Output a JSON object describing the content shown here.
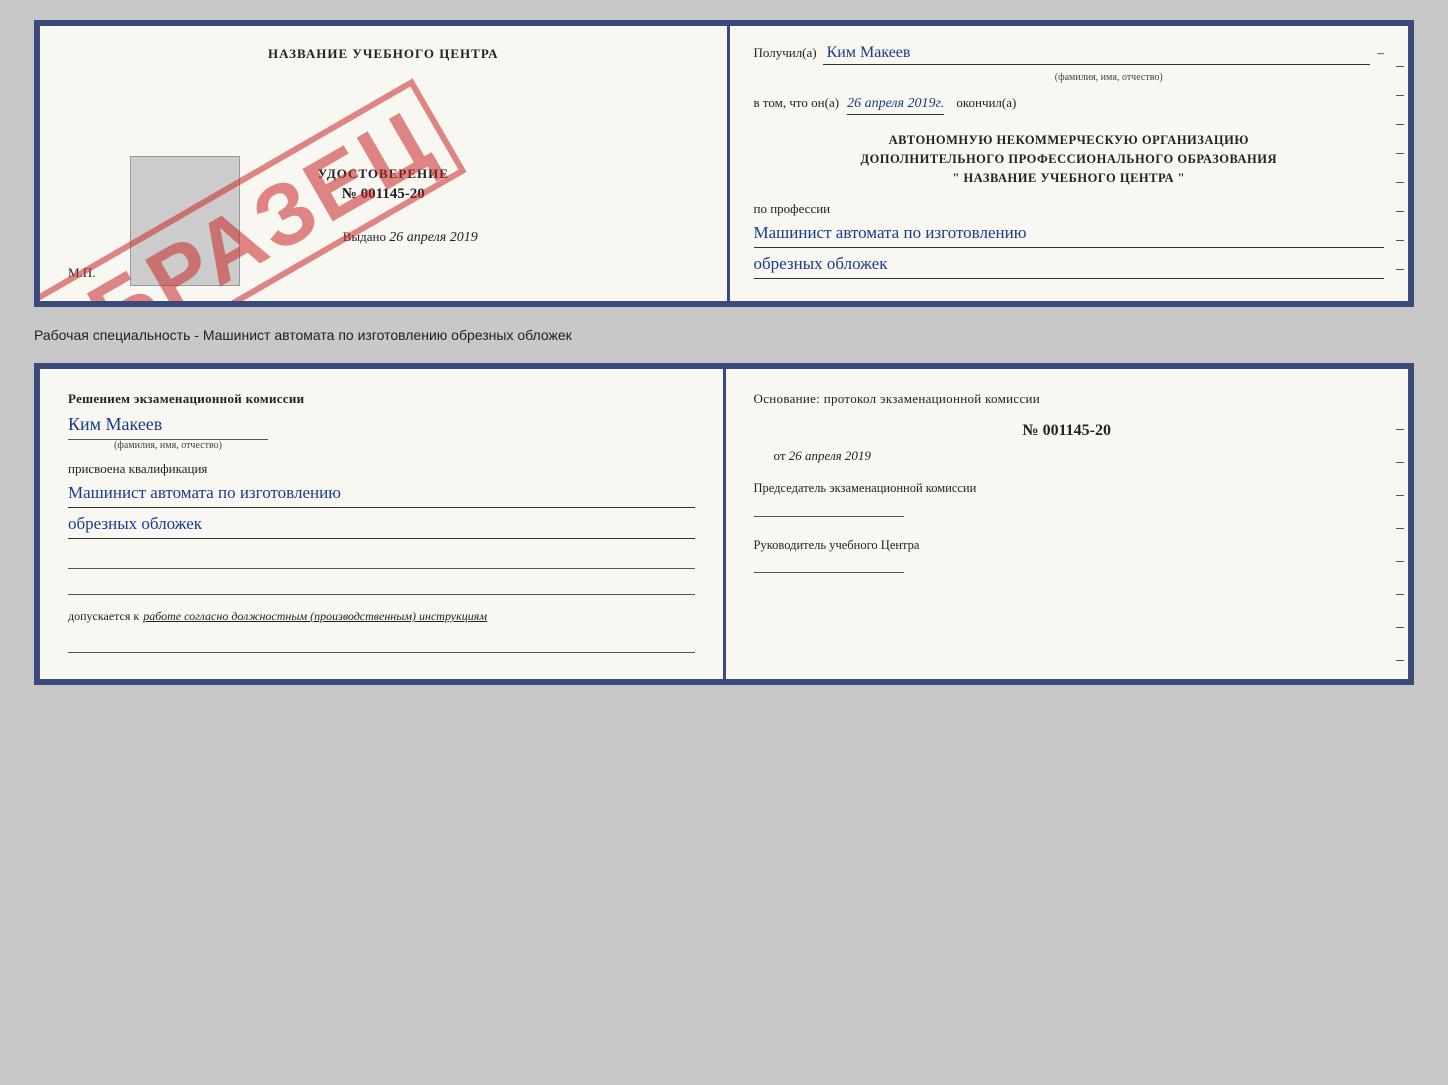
{
  "top_doc": {
    "left": {
      "center_title": "НАЗВАНИЕ УЧЕБНОГО ЦЕНТРА",
      "stamp": "ОБРАЗЕЦ",
      "udc_label": "УДОСТОВЕРЕНИЕ",
      "udc_number": "№ 001145-20",
      "vydano_prefix": "Выдано",
      "vydano_date": "26 апреля 2019",
      "mp_label": "М.П."
    },
    "right": {
      "poluchil_label": "Получил(а)",
      "fam_name": "Ким Макеев",
      "fam_sub": "(фамилия, имя, отчество)",
      "vtom_label": "в том, что он(а)",
      "vtom_date": "26 апреля 2019г.",
      "okonchil_label": "окончил(а)",
      "org_line1": "АВТОНОМНУЮ НЕКОММЕРЧЕСКУЮ ОРГАНИЗАЦИЮ",
      "org_line2": "ДОПОЛНИТЕЛЬНОГО ПРОФЕССИОНАЛЬНОГО ОБРАЗОВАНИЯ",
      "org_line3": "\"   НАЗВАНИЕ УЧЕБНОГО ЦЕНТРА   \"",
      "po_professii": "по профессии",
      "profession_line1": "Машинист автомата по изготовлению",
      "profession_line2": "обрезных обложек"
    }
  },
  "caption": "Рабочая специальность - Машинист автомата по изготовлению обрезных обложек",
  "bottom_doc": {
    "left": {
      "title_line1": "Решением экзаменационной комиссии",
      "name": "Ким Макеев",
      "fio_sub": "(фамилия, имя, отчество)",
      "prisvoena": "присвоена квалификация",
      "qual_line1": "Машинист автомата по изготовлению",
      "qual_line2": "обрезных обложек",
      "dopusk_prefix": "допускается к",
      "dopusk_text": "работе согласно должностным (производственным) инструкциям"
    },
    "right": {
      "osnov_label": "Основание: протокол экзаменационной комиссии",
      "protocol_number": "№ 001145-20",
      "ot_prefix": "от",
      "ot_date": "26 апреля 2019",
      "predsedatel_label": "Председатель экзаменационной комиссии",
      "rukovoditel_label": "Руководитель учебного Центра"
    }
  }
}
